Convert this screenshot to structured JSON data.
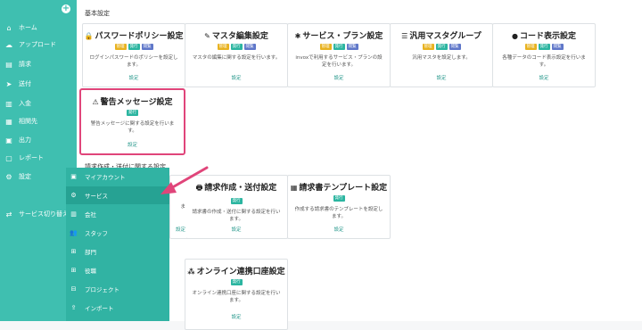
{
  "sidebar": {
    "collapse_icon": "+",
    "items": [
      {
        "label": "ホーム",
        "icon": "⌂"
      },
      {
        "label": "アップロード",
        "icon": "☁"
      },
      {
        "label": "請求",
        "icon": "▤"
      },
      {
        "label": "送付",
        "icon": "➤"
      },
      {
        "label": "入金",
        "icon": "▥"
      },
      {
        "label": "相関先",
        "icon": "▦"
      },
      {
        "label": "出力",
        "icon": "▣"
      },
      {
        "label": "レポート",
        "icon": "▢"
      },
      {
        "label": "設定",
        "icon": "⚙"
      },
      {
        "label": "サービス切り替え",
        "icon": "⇄"
      }
    ]
  },
  "sections": {
    "basic": "基本設定",
    "invoice": "請求作成・送付に関する設定"
  },
  "badges": {
    "admin": "管理",
    "send": "発行",
    "view": "閲覧"
  },
  "cards": [
    {
      "title": "パスワードポリシー設定",
      "icon": "🔒",
      "desc": "ログインパスワードのポリシーを設定します。",
      "link": "設定"
    },
    {
      "title": "マスタ編集設定",
      "icon": "✎",
      "desc": "マスタの編集に関する設定を行います。",
      "link": "設定"
    },
    {
      "title": "サービス・プラン設定",
      "icon": "✱",
      "desc": "invoxで利用するサービス・プランの設定を行います。",
      "link": "設定"
    },
    {
      "title": "汎用マスタグループ",
      "icon": "☰",
      "desc": "汎用マスタを設定します。",
      "link": "設定"
    },
    {
      "title": "コード表示設定",
      "icon": "●",
      "desc": "各種データのコード表示設定を行います。",
      "link": "設定"
    },
    {
      "title": "警告メッセージ設定",
      "icon": "⚠",
      "desc": "警告メッセージに関する設定を行います。",
      "link": "設定"
    },
    {
      "title": "請求作成・送付設定",
      "icon": "🖶",
      "desc": "請求書の作成・送付に関する設定を行います。",
      "link": "設定"
    },
    {
      "title": "請求書テンプレート設定",
      "icon": "▦",
      "desc": "作成する請求書のテンプレートを設定します。",
      "link": "設定"
    },
    {
      "title": "オンライン連携口座設定",
      "icon": "⁂",
      "desc": "オンライン連携口座に関する設定を行います。",
      "link": "設定"
    }
  ],
  "dropdown": {
    "items": [
      {
        "label": "マイアカウント",
        "icon": "▣"
      },
      {
        "label": "サービス",
        "icon": "⚙"
      },
      {
        "label": "会社",
        "icon": "▥"
      },
      {
        "label": "スタッフ",
        "icon": "👥"
      },
      {
        "label": "部門",
        "icon": "⊞"
      },
      {
        "label": "役職",
        "icon": "⊞"
      },
      {
        "label": "プロジェクト",
        "icon": "⊟"
      },
      {
        "label": "インポート",
        "icon": "⇪"
      }
    ],
    "peek_text": "ま",
    "peek_link": "設定"
  },
  "colors": {
    "sidebar": "#3fbfb0",
    "highlight": "#e0457a",
    "accent": "#2bb5a0"
  }
}
